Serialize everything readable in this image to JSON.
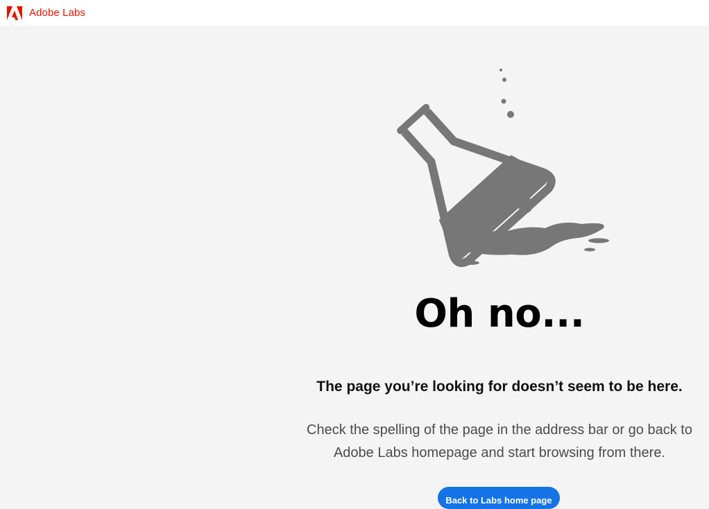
{
  "header": {
    "brand_name": "Adobe Labs",
    "brand_color": "#eb1000",
    "logo_icon": "adobe-logo-icon"
  },
  "main": {
    "illustration_icon": "spilled-flask-icon",
    "heading": "Oh no...",
    "subheading": "The page you’re looking for doesn’t seem to be here.",
    "body_line_1": "Check the spelling of the page in the address bar or go back to",
    "body_line_2": "Adobe Labs homepage and start browsing from there.",
    "button_label": "Back to Labs home page",
    "button_color": "#1473e6"
  }
}
